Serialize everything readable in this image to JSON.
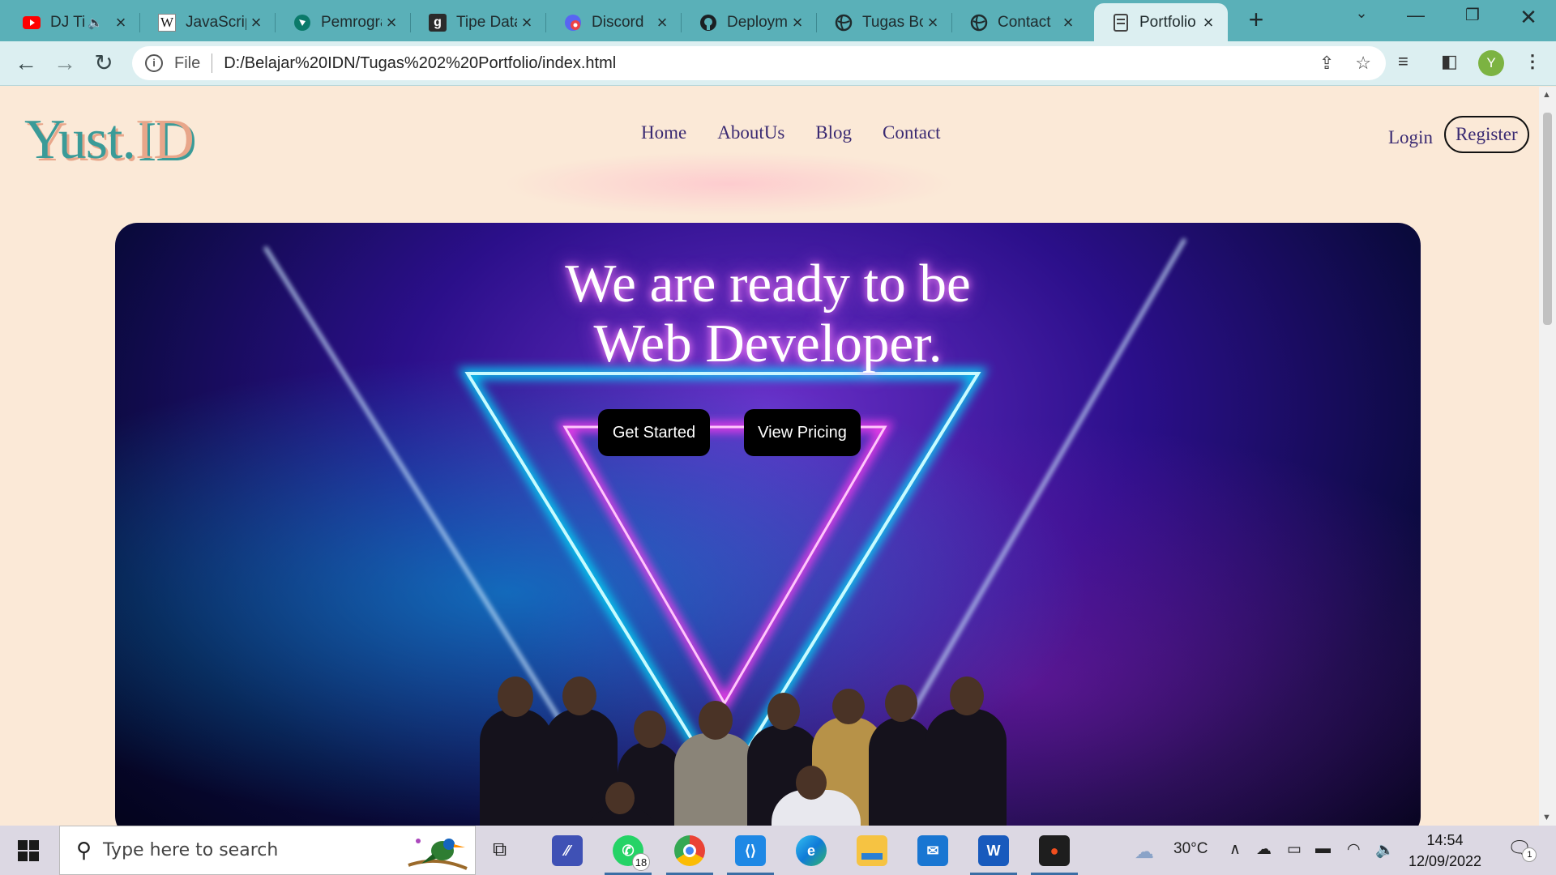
{
  "browser": {
    "tabs": [
      {
        "label": "DJ Ti",
        "icon": "youtube-icon",
        "muted": true
      },
      {
        "label": "JavaScrip",
        "icon": "wikipedia-icon"
      },
      {
        "label": "Pemrogra",
        "icon": "site-icon"
      },
      {
        "label": "Tipe Data",
        "icon": "g-icon"
      },
      {
        "label": "Discord",
        "icon": "discord-icon"
      },
      {
        "label": "Deploym",
        "icon": "github-icon"
      },
      {
        "label": "Tugas Bo",
        "icon": "globe-icon"
      },
      {
        "label": "Contact",
        "icon": "globe-icon"
      },
      {
        "label": "Portfolio",
        "icon": "page-icon",
        "active": true
      }
    ],
    "omnibox": {
      "scheme_label": "File",
      "url": "D:/Belajar%20IDN/Tugas%202%20Portfolio/index.html"
    },
    "profile_initial": "Y"
  },
  "site": {
    "logo_part1": "Yust.",
    "logo_part2": "ID",
    "nav": [
      "Home",
      "AboutUs",
      "Blog",
      "Contact"
    ],
    "login": "Login",
    "register": "Register"
  },
  "hero": {
    "headline_line1": "We are ready to be",
    "headline_line2": "Web Developer.",
    "btn_primary": "Get Started",
    "btn_secondary": "View Pricing"
  },
  "taskbar": {
    "search_placeholder": "Type here to search",
    "whatsapp_badge": "18",
    "weather": "30°C",
    "time": "14:54",
    "date": "12/09/2022",
    "notification_count": "1"
  },
  "colors": {
    "tabstrip": "#5ab0b8",
    "logo_teal": "#3a9b98",
    "logo_peach": "#e8a68a",
    "nav_text": "#3a2a72",
    "page_bg": "#fbe9d7"
  }
}
